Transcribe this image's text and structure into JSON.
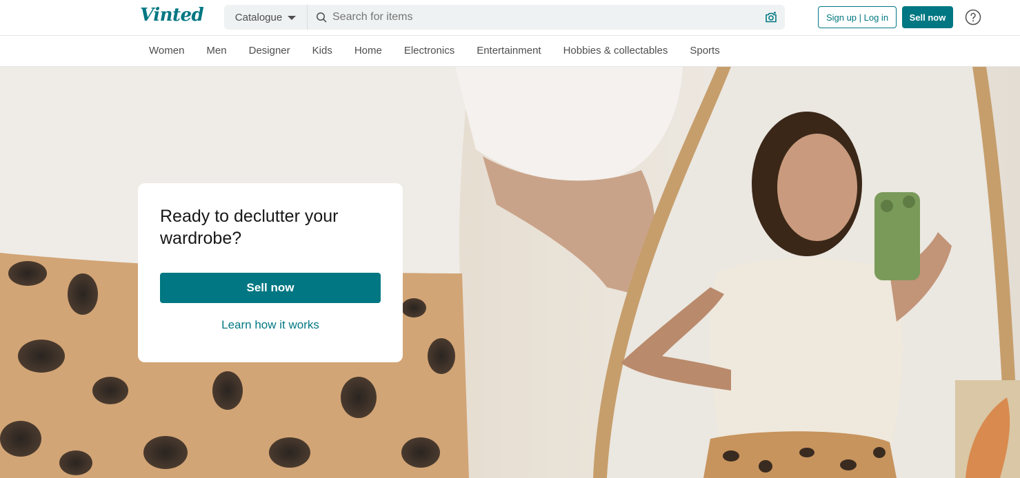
{
  "header": {
    "logo_text": "Vinted",
    "catalogue_label": "Catalogue",
    "search_placeholder": "Search for items",
    "signup_label": "Sign up | Log in",
    "sell_label": "Sell now",
    "help_icon": "question-circle-icon"
  },
  "nav": {
    "items": [
      {
        "label": "Women"
      },
      {
        "label": "Men"
      },
      {
        "label": "Designer"
      },
      {
        "label": "Kids"
      },
      {
        "label": "Home"
      },
      {
        "label": "Electronics"
      },
      {
        "label": "Entertainment"
      },
      {
        "label": "Hobbies & collectables"
      },
      {
        "label": "Sports"
      }
    ]
  },
  "hero": {
    "title": "Ready to declutter your wardrobe?",
    "sell_label": "Sell now",
    "learn_label": "Learn how it works"
  },
  "colors": {
    "brand": "#007782",
    "text": "#171717",
    "muted": "#4d4d4d"
  }
}
